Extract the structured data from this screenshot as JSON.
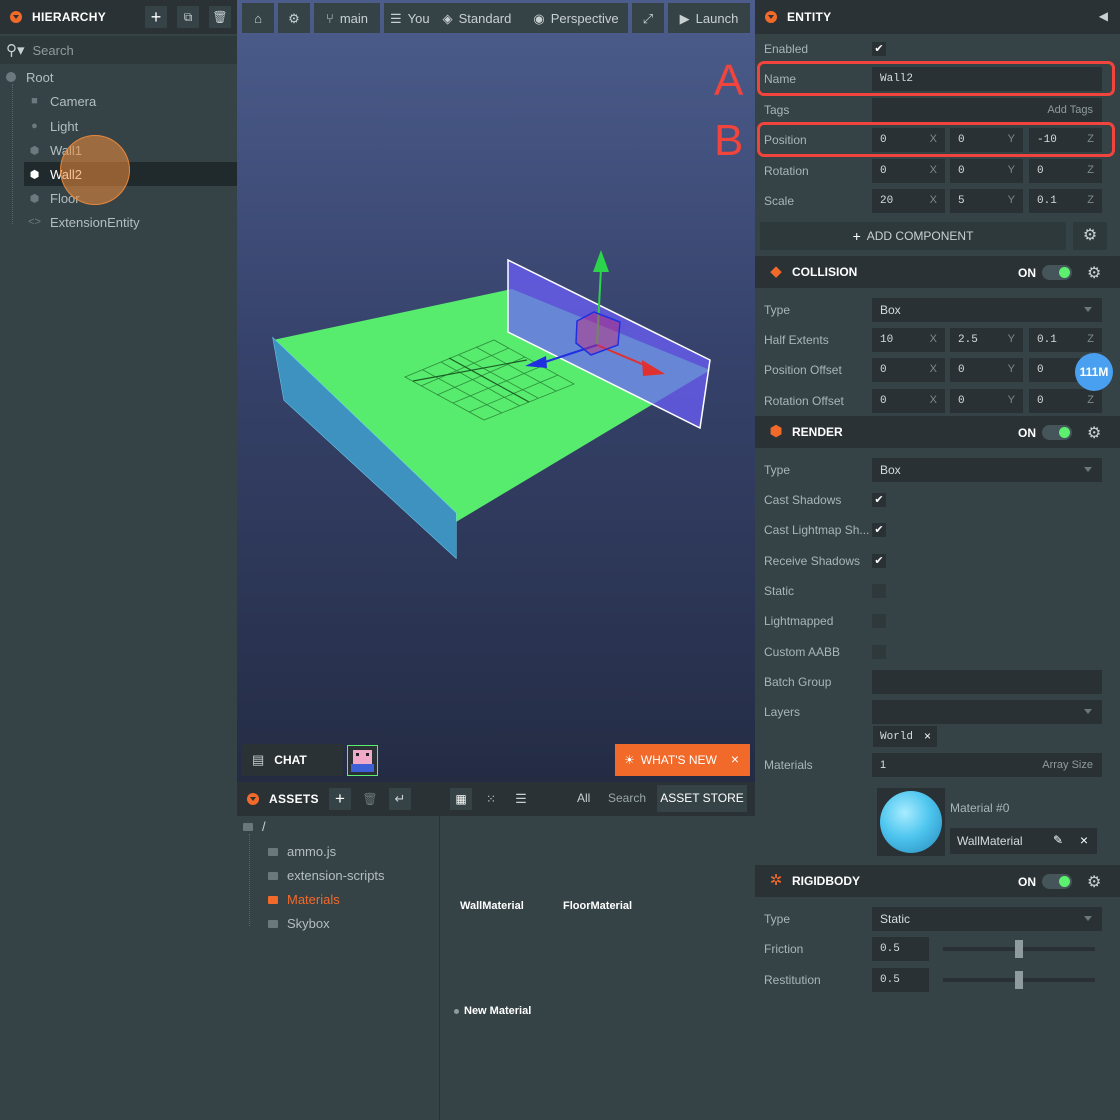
{
  "hierarchy": {
    "title": "HIERARCHY",
    "search_placeholder": "Search",
    "items": [
      {
        "label": "Root",
        "icon": "circle-icon"
      },
      {
        "label": "Camera",
        "icon": "camera-icon"
      },
      {
        "label": "Light",
        "icon": "light-icon"
      },
      {
        "label": "Wall1",
        "icon": "entity-icon"
      },
      {
        "label": "Wall2",
        "icon": "entity-icon"
      },
      {
        "label": "Floor",
        "icon": "entity-icon"
      },
      {
        "label": "ExtensionEntity",
        "icon": "code-icon"
      }
    ]
  },
  "toolbar": {
    "branch": "main",
    "scene": "Your... E_A...",
    "render_mode": "Standard",
    "camera": "Perspective",
    "launch": "Launch"
  },
  "viewport": {
    "chat": "CHAT",
    "whats_new": "WHAT'S NEW"
  },
  "assets": {
    "title": "ASSETS",
    "filter": "All",
    "search": "Search",
    "store": "ASSET STORE",
    "root": "/",
    "folders": [
      "ammo.js",
      "extension-scripts",
      "Materials",
      "Skybox"
    ],
    "items": [
      "WallMaterial",
      "FloorMaterial"
    ],
    "new_item": "New Material"
  },
  "entity": {
    "title": "ENTITY",
    "enabled_label": "Enabled",
    "name_label": "Name",
    "name_value": "Wall2",
    "tags_label": "Tags",
    "add_tags": "Add Tags",
    "position_label": "Position",
    "position": [
      "0",
      "0",
      "-10"
    ],
    "rotation_label": "Rotation",
    "rotation": [
      "0",
      "0",
      "0"
    ],
    "scale_label": "Scale",
    "scale": [
      "20",
      "5",
      "0.1"
    ],
    "add_component": "ADD COMPONENT",
    "axes": [
      "X",
      "Y",
      "Z"
    ]
  },
  "collision": {
    "title": "COLLISION",
    "on": "ON",
    "type_label": "Type",
    "type": "Box",
    "half_extents_label": "Half Extents",
    "half_extents": [
      "10",
      "2.5",
      "0.1"
    ],
    "position_offset_label": "Position Offset",
    "position_offset": [
      "0",
      "0",
      "0"
    ],
    "rotation_offset_label": "Rotation Offset",
    "rotation_offset": [
      "0",
      "0",
      "0"
    ],
    "badge": "111M"
  },
  "render": {
    "title": "RENDER",
    "on": "ON",
    "type_label": "Type",
    "type": "Box",
    "cast_shadows": "Cast Shadows",
    "cast_lightmap": "Cast Lightmap Sh...",
    "receive_shadows": "Receive Shadows",
    "static": "Static",
    "lightmapped": "Lightmapped",
    "custom_aabb": "Custom AABB",
    "batch_group": "Batch Group",
    "layers": "Layers",
    "layer_tag": "World",
    "materials_label": "Materials",
    "materials_count": "1",
    "array_size": "Array Size",
    "material_slot": "Material #0",
    "material_name": "WallMaterial"
  },
  "rigidbody": {
    "title": "RIGIDBODY",
    "on": "ON",
    "type_label": "Type",
    "type": "Static",
    "friction_label": "Friction",
    "friction": "0.5",
    "restitution_label": "Restitution",
    "restitution": "0.5"
  },
  "annotations": {
    "a": "A",
    "b": "B"
  }
}
